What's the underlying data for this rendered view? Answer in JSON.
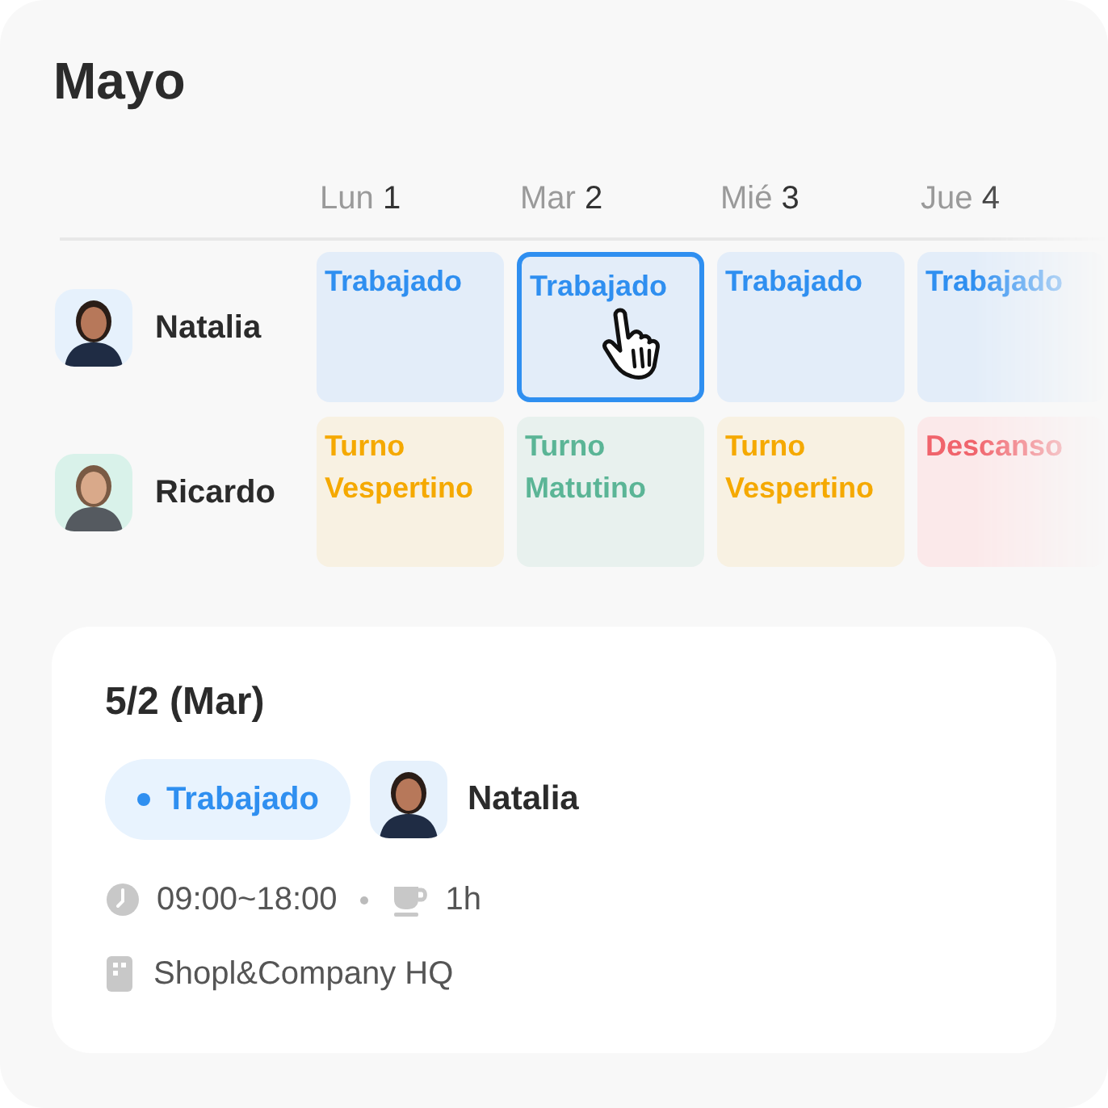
{
  "title": "Mayo",
  "days": [
    {
      "weekday": "Lun",
      "date": "1"
    },
    {
      "weekday": "Mar",
      "date": "2"
    },
    {
      "weekday": "Mié",
      "date": "3"
    },
    {
      "weekday": "Jue",
      "date": "4"
    }
  ],
  "employees": [
    {
      "name": "Natalia",
      "shifts": [
        {
          "kind": "worked",
          "label": "Trabajado",
          "selected": false
        },
        {
          "kind": "worked",
          "label": "Trabajado",
          "selected": true
        },
        {
          "kind": "worked",
          "label": "Trabajado",
          "selected": false
        },
        {
          "kind": "worked",
          "label": "Trabajado",
          "selected": false
        }
      ]
    },
    {
      "name": "Ricardo",
      "shifts": [
        {
          "kind": "evening",
          "label": "Turno Vespertino",
          "selected": false
        },
        {
          "kind": "morning",
          "label": "Turno Matutino",
          "selected": false
        },
        {
          "kind": "evening",
          "label": "Turno Vespertino",
          "selected": false
        },
        {
          "kind": "rest",
          "label": "Descanso",
          "selected": false
        }
      ]
    }
  ],
  "detail": {
    "date": "5/2 (Mar)",
    "status": {
      "kind": "worked",
      "label": "Trabajado"
    },
    "employee": "Natalia",
    "hours": "09:00~18:00",
    "break": "1h",
    "location": "Shopl&Company HQ"
  }
}
